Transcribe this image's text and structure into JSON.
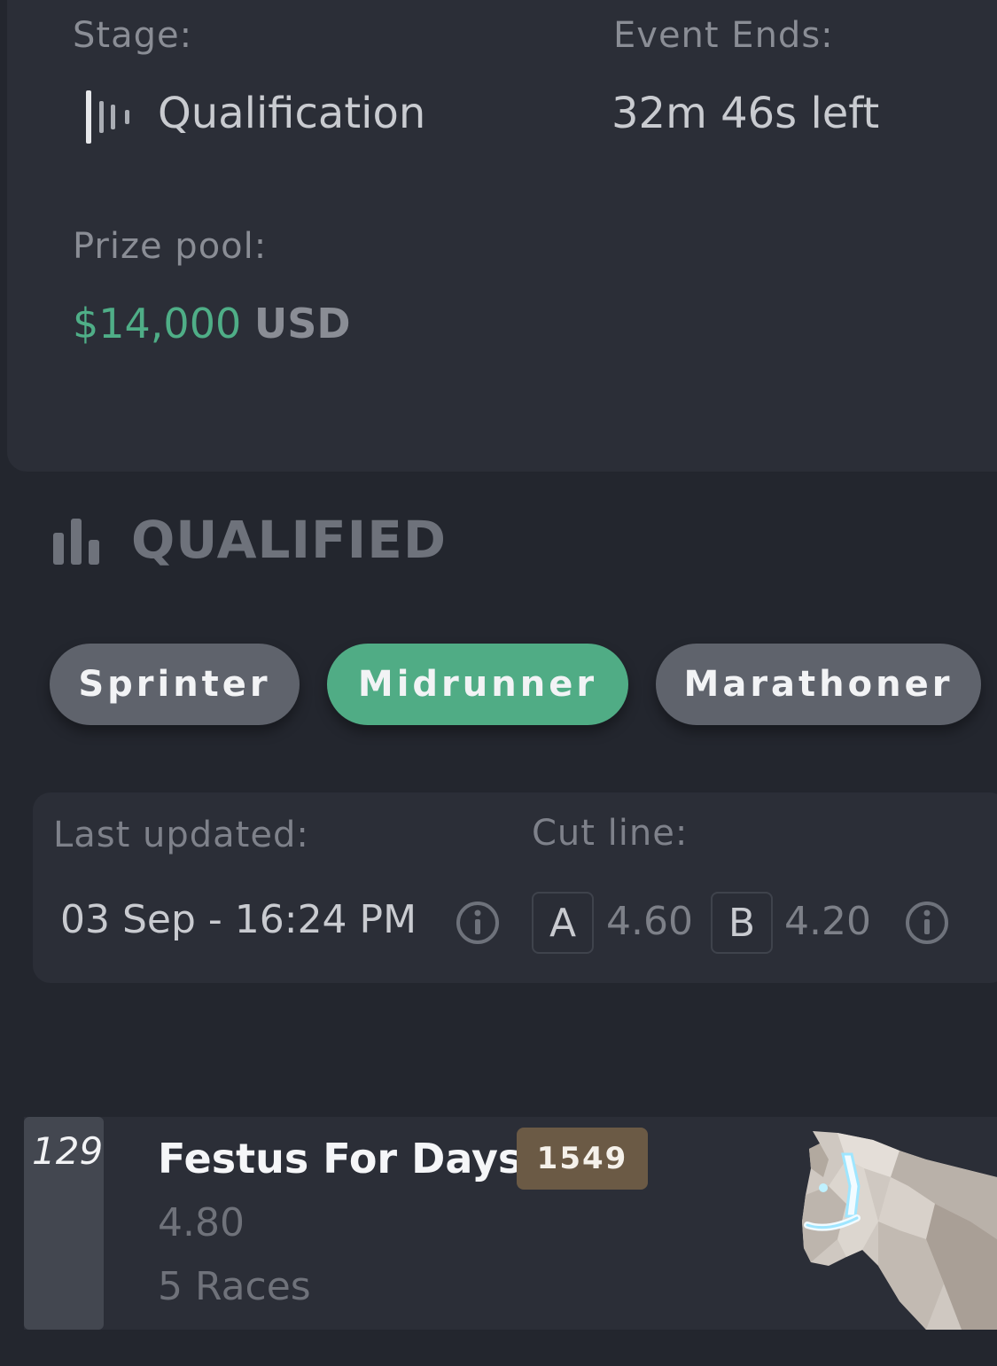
{
  "event": {
    "stage_label": "Stage:",
    "stage_value": "Qualification",
    "stage_icon": "stage-bars-icon",
    "ends_label": "Event Ends:",
    "ends_value": "32m 46s left",
    "prize_label": "Prize pool:",
    "prize_amount": "$14,000",
    "prize_currency": "USD"
  },
  "section": {
    "title": "QUALIFIED",
    "icon": "bar-chart-icon"
  },
  "tabs": [
    {
      "label": "Sprinter",
      "active": false
    },
    {
      "label": "Midrunner",
      "active": true
    },
    {
      "label": "Marathoner",
      "active": false
    }
  ],
  "info": {
    "updated_label": "Last updated:",
    "updated_value": "03 Sep - 16:24 PM",
    "cut_label": "Cut line:",
    "cut_a_label": "A",
    "cut_a_value": "4.60",
    "cut_b_label": "B",
    "cut_b_value": "4.20"
  },
  "horses": [
    {
      "rank": "129",
      "name": "Festus For Days",
      "badge": "1549",
      "score": "4.80",
      "races": "5 Races"
    }
  ],
  "colors": {
    "background": "#23262e",
    "card": "#2b2e37",
    "accent_green": "#50ac85",
    "prize_green": "#4fae87",
    "tab_inactive": "#5f636c",
    "badge_brown": "#6b5a45"
  }
}
